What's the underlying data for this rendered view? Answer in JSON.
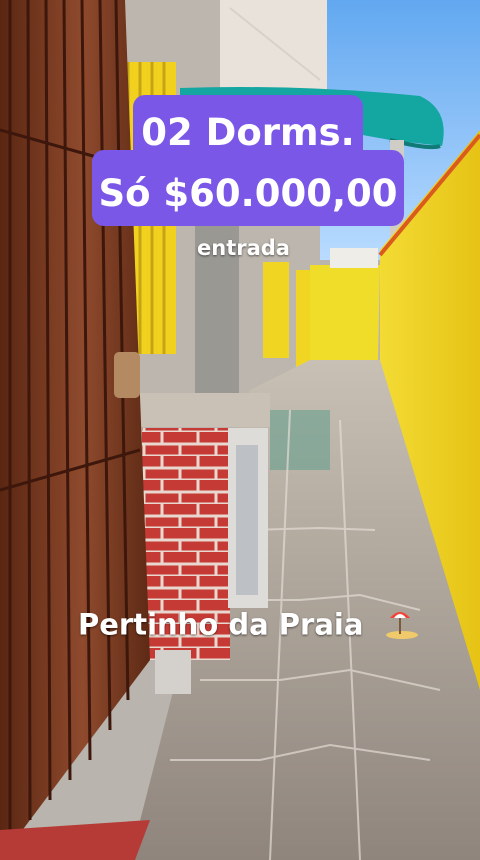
{
  "overlay": {
    "line1": "02 Dorms.",
    "line2": "Só $60.000,00",
    "entrada": "entrada",
    "praia": "Pertinho da Praia"
  },
  "icons": {
    "praia": "beach-umbrella-icon"
  },
  "colors": {
    "title_bg": "#7b57e8",
    "yellow_wall": "#f0da25",
    "door": "#7a3d22",
    "brick": "#c8322d"
  }
}
